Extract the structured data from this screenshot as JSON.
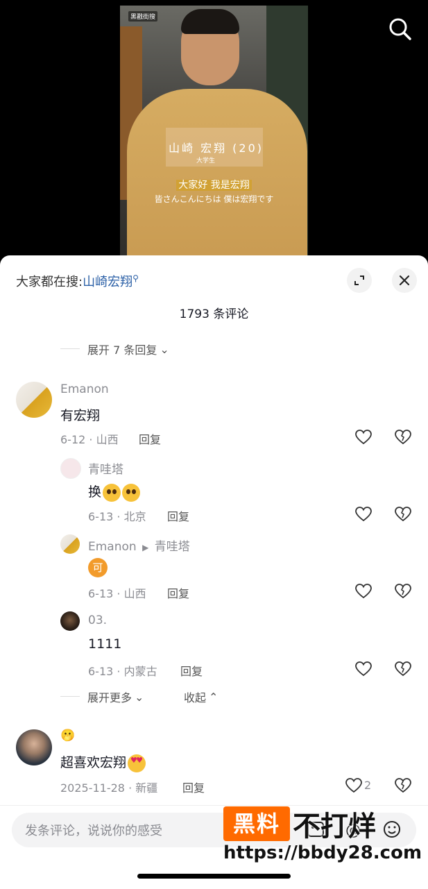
{
  "video": {
    "channel_logo": "黑戳街搜",
    "name_caption": "山崎 宏翔 (20)",
    "role_caption": "大学生",
    "subtitle_cn": "大家好  我是宏翔",
    "subtitle_jp": "皆さんこんにちは 僕は宏翔です",
    "search_icon": "search-icon"
  },
  "header": {
    "topic_prefix": "大家都在搜:",
    "topic_link": "山崎宏翔",
    "comment_count": "1793 条评论",
    "expand_icon": "expand-icon",
    "close_icon": "close-icon"
  },
  "expand_top": "展开 7 条回复",
  "comments": [
    {
      "user": "Emanon",
      "text": "有宏翔",
      "date_loc": "6-12 · 山西",
      "reply_label": "回复"
    },
    {
      "user": "青哇塔",
      "text": "换",
      "date_loc": "6-13 · 北京",
      "reply_label": "回复"
    },
    {
      "user": "Emanon",
      "reply_to": "青哇塔",
      "text": "可",
      "date_loc": "6-13 · 山西",
      "reply_label": "回复"
    },
    {
      "user": "03.",
      "text": "1111",
      "date_loc": "6-13 · 内蒙古",
      "reply_label": "回复"
    },
    {
      "user": "🫢",
      "text": "超喜欢宏翔",
      "date_loc": "2025-11-28 · 新疆",
      "reply_label": "回复",
      "likes": "2"
    }
  ],
  "expand_more": "展开更多",
  "collapse": "收起",
  "composer": {
    "placeholder": "发条评论，说说你的感受"
  },
  "watermark": {
    "badge": "黑料",
    "text": "不打烊",
    "url": "https://bbdy28.com"
  },
  "colors": {
    "link": "#2a5fa6",
    "muted": "#8a8b91",
    "watermark_orange": "#ff6a00"
  }
}
